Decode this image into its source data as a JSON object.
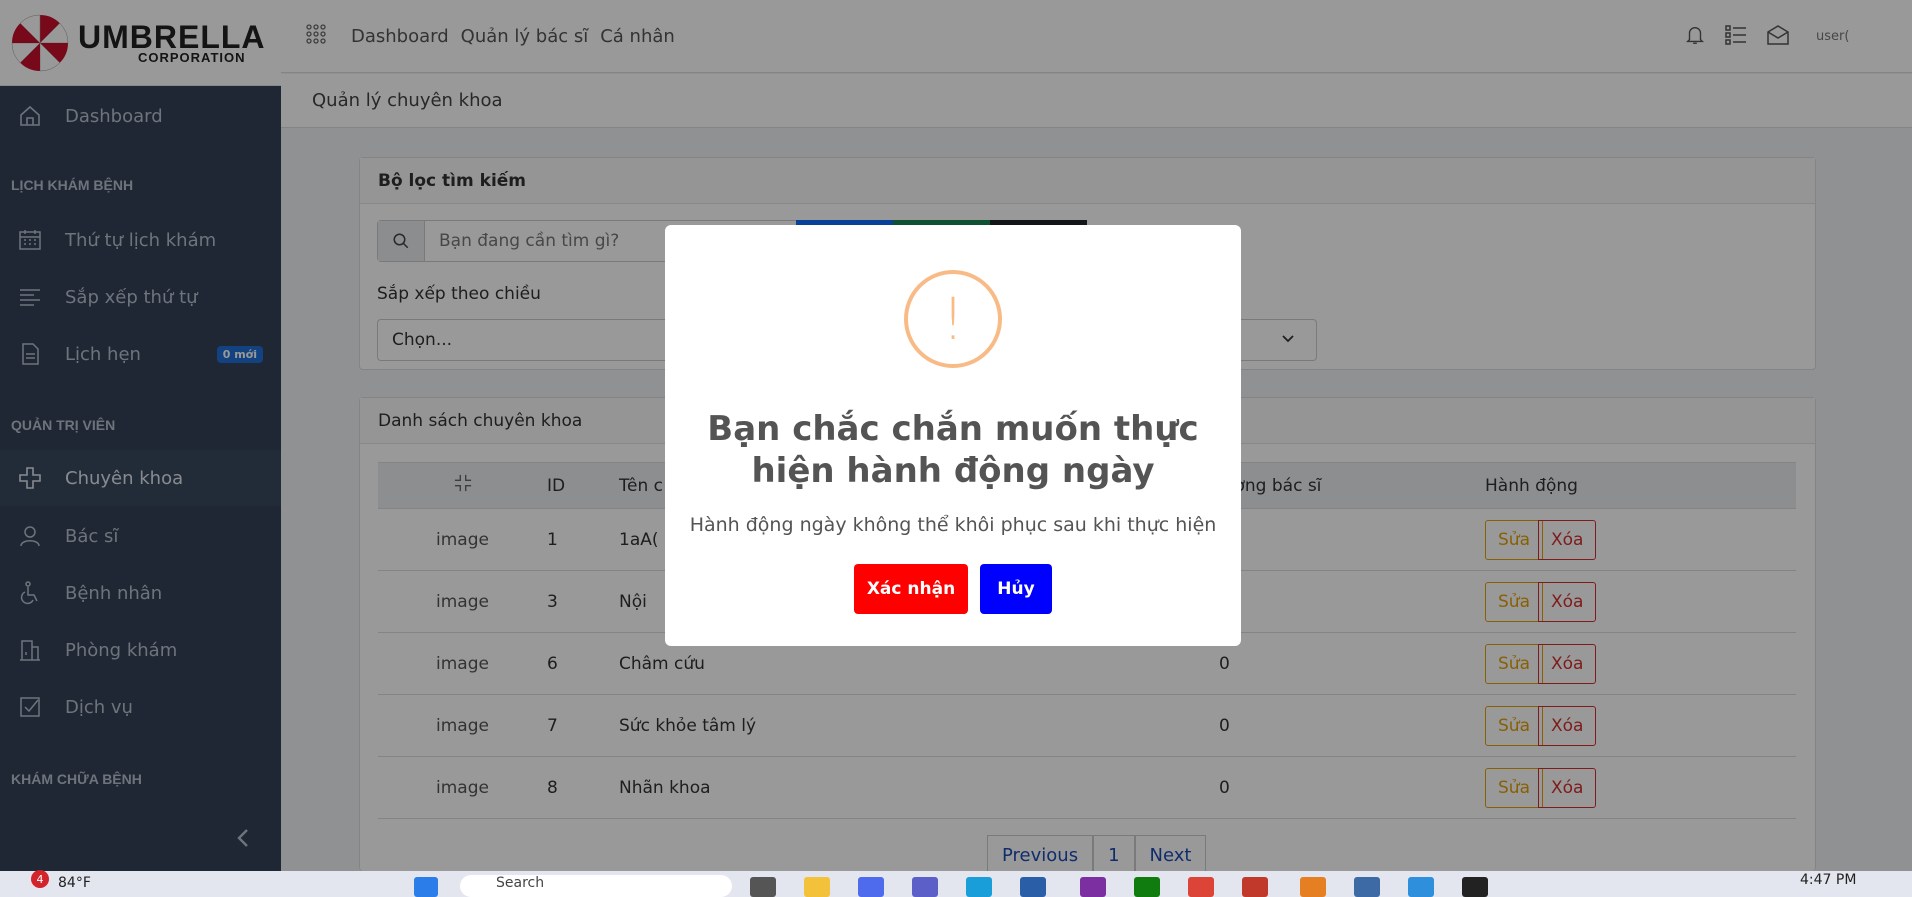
{
  "app": {
    "logo_big": "UMBRELLA",
    "logo_small": "CORPORATION"
  },
  "sidebar": {
    "dashboard": "Dashboard",
    "section_schedule": "LỊCH KHÁM BỆNH",
    "schedule_items": [
      "Thứ tự lịch khám",
      "Sắp xếp thứ tự",
      "Lịch hẹn"
    ],
    "appointments_badge": "0 mới",
    "section_admin": "QUẢN TRỊ VIÊN",
    "admin_items": [
      "Chuyên khoa",
      "Bác sĩ",
      "Bệnh nhân",
      "Phòng khám",
      "Dịch vụ"
    ],
    "section_treatment": "KHÁM CHỮA BỆNH"
  },
  "topbar": {
    "links": [
      "Dashboard",
      "Quản lý bác sĩ",
      "Cá nhân"
    ],
    "user_alt": "user("
  },
  "breadcrumb": "Quản lý chuyên khoa",
  "filter": {
    "title": "Bộ lọc tìm kiếm",
    "search_placeholder": "Bạn đang cần tìm gì?",
    "sort_label": "Sắp xếp theo chiều",
    "sort_value": "Chọn..."
  },
  "list": {
    "title": "Danh sách chuyên khoa",
    "columns": [
      "ID",
      "Tên c",
      "lượng bác sĩ",
      "Hành động"
    ],
    "rows": [
      {
        "img": "image",
        "id": "1",
        "name": "1aA(",
        "count": ""
      },
      {
        "img": "image",
        "id": "3",
        "name": "Nội",
        "count": ""
      },
      {
        "img": "image",
        "id": "6",
        "name": "Châm cứu",
        "count": "0"
      },
      {
        "img": "image",
        "id": "7",
        "name": "Sức khỏe tâm lý",
        "count": "0"
      },
      {
        "img": "image",
        "id": "8",
        "name": "Nhãn khoa",
        "count": "0"
      }
    ],
    "edit_label": "Sửa",
    "delete_label": "Xóa",
    "pager": [
      "Previous",
      "1",
      "Next"
    ]
  },
  "modal": {
    "icon": "!",
    "title": "Bạn chắc chắn muốn thực hiện hành động ngày",
    "text": "Hành động ngày không thể khôi phục sau khi thực hiện",
    "confirm": "Xác nhận",
    "cancel": "Hủy",
    "confirm_color": "#ff0000",
    "cancel_color": "#0000ff"
  },
  "taskbar": {
    "notif_count": "4",
    "temp": "84°F",
    "search_text": "Search",
    "time": "4:47 PM"
  }
}
